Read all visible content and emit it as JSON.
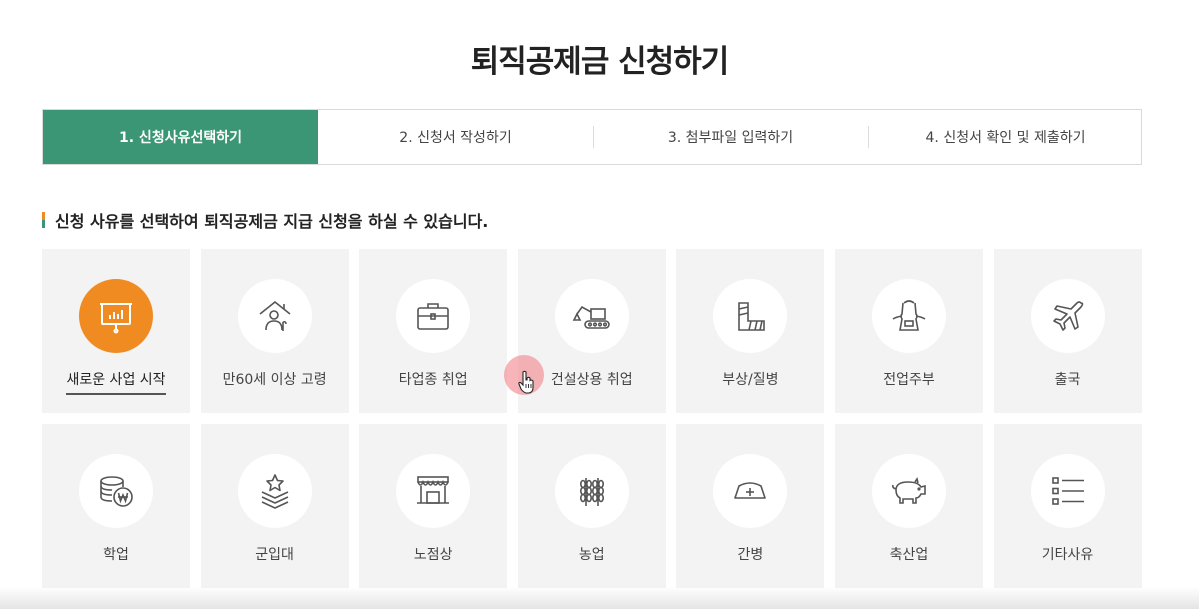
{
  "page": {
    "title": "퇴직공제금 신청하기"
  },
  "steps": [
    {
      "label": "1. 신청사유선택하기",
      "active": true
    },
    {
      "label": "2. 신청서 작성하기",
      "active": false
    },
    {
      "label": "3. 첨부파일 입력하기",
      "active": false
    },
    {
      "label": "4. 신청서 확인 및 제출하기",
      "active": false
    }
  ],
  "section": {
    "heading": "신청 사유를 선택하여 퇴직공제금 지급 신청을 하실 수 있습니다."
  },
  "reasons": [
    {
      "label": "새로운 사업 시작",
      "icon": "presentation-board-icon",
      "active": true
    },
    {
      "label": "만60세 이상 고령",
      "icon": "elderly-person-house-icon",
      "active": false
    },
    {
      "label": "타업종 취업",
      "icon": "briefcase-icon",
      "active": false
    },
    {
      "label": "건설상용 취업",
      "icon": "excavator-icon",
      "active": false
    },
    {
      "label": "부상/질병",
      "icon": "cast-arm-icon",
      "active": false
    },
    {
      "label": "전업주부",
      "icon": "apron-icon",
      "active": false
    },
    {
      "label": "출국",
      "icon": "airplane-icon",
      "active": false
    },
    {
      "label": "학업",
      "icon": "coins-won-icon",
      "active": false
    },
    {
      "label": "군입대",
      "icon": "military-rank-star-icon",
      "active": false
    },
    {
      "label": "노점상",
      "icon": "market-stall-icon",
      "active": false
    },
    {
      "label": "농업",
      "icon": "wheat-icon",
      "active": false
    },
    {
      "label": "간병",
      "icon": "nurse-cap-icon",
      "active": false
    },
    {
      "label": "축산업",
      "icon": "pig-icon",
      "active": false
    },
    {
      "label": "기타사유",
      "icon": "list-icon",
      "active": false
    }
  ],
  "colors": {
    "accent_green": "#3a9674",
    "accent_orange": "#f08b22",
    "card_bg": "#f3f3f4"
  }
}
